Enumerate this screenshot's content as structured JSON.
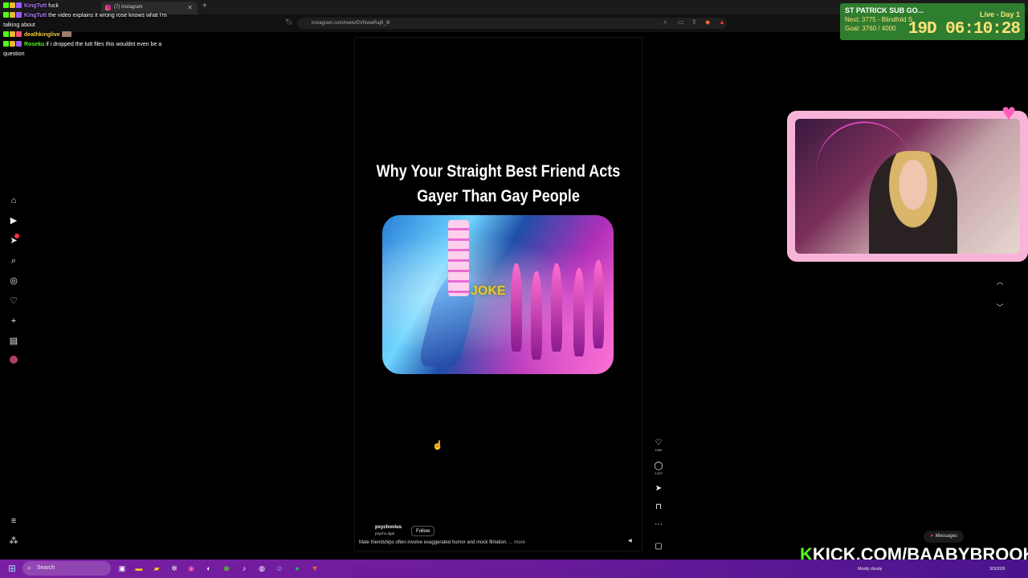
{
  "browser": {
    "tab_title": "(7) Instagram",
    "url": "instagram.com/reels/DVNwwRaj9_9/"
  },
  "chat": [
    {
      "user": "KingTutt",
      "msg": "fuck"
    },
    {
      "user": "KingTutt",
      "msg": "the video explains it wrong rose knows what I'm talking about"
    },
    {
      "user": "deathkinglive",
      "msg": ""
    },
    {
      "user": "Roseku",
      "msg": "if i dropped the tutt files this wouldnt even be a question"
    }
  ],
  "timer": {
    "title": "ST PATRICK SUB GO...",
    "live": "Live - Day 1",
    "next": "Next: 3775 - Blindfold S",
    "goal": "Goal: 3760 / 4000",
    "clock": "19D 06:10:28"
  },
  "reel": {
    "title_line1": "Why Your Straight Best Friend Acts",
    "title_line2": "Gayer Than Gay People",
    "image_text": "JOKE",
    "likes": "106K",
    "comments": "2,507",
    "author": "psychovius",
    "author_sub": "psycho.dgal",
    "follow_label": "Follow",
    "description": "Male friendships often involve exaggerated humor and mock flirtation.",
    "more_label": "... more"
  },
  "messages_label": "Messages",
  "kick_banner": {
    "k": "K",
    "text": "KICK.COM/BAABYBROOK"
  },
  "taskbar": {
    "search_placeholder": "Search",
    "weather": "Mostly cloudy",
    "date": "3/3/2026"
  },
  "colors": {
    "kick_green": "#53fc18",
    "timer_bg": "#2f7d2f",
    "webcam_frame": "#f8b4d8",
    "taskbar": "#7b1fa2"
  }
}
